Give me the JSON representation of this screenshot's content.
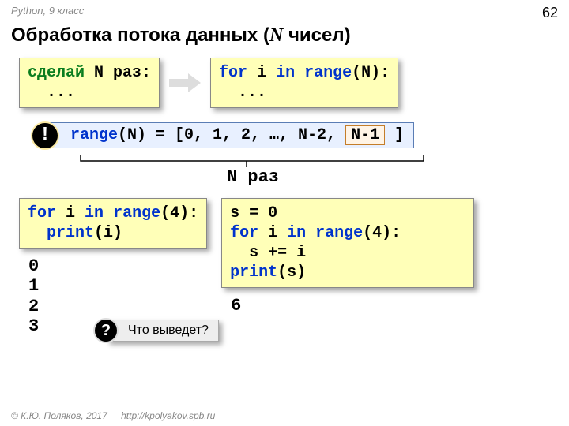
{
  "header": {
    "course": "Python, 9 класс",
    "page": "62"
  },
  "title": {
    "a": "Обработка потока данных (",
    "ital": "N",
    "b": " чисел)"
  },
  "box_pseudo": {
    "l1a": "сделай",
    "l1b": " N раз",
    "l1c": ":",
    "l2": "  ..."
  },
  "box_for": {
    "l1a": "for",
    "l1b": " i ",
    "l1c": "in",
    "l1d": " ",
    "l1e": "range",
    "l1f": "(N):",
    "l2": "  ..."
  },
  "range_line": {
    "a": "range",
    "b": "(N) = [0, 1, 2, …, N-2, ",
    "boxed": "N-1",
    "d": " ]"
  },
  "bracket_label": "N раз",
  "box_for4": {
    "l1a": "for",
    "l1b": " i ",
    "l1c": "in",
    "l1d": " ",
    "l1e": "range",
    "l1f": "(4):",
    "l2a": "  ",
    "l2b": "print",
    "l2c": "(i)"
  },
  "box_sum": {
    "l1": "s = 0",
    "l2a": "for",
    "l2b": " i ",
    "l2c": "in",
    "l2d": " ",
    "l2e": "range",
    "l2f": "(4):",
    "l3": "  s += i",
    "l4a": "print",
    "l4b": "(s)"
  },
  "out_left": [
    "0",
    "1",
    "2",
    "3"
  ],
  "out_right": "6",
  "q_text": "Что выведет?",
  "badge_excl": "!",
  "badge_q": "?",
  "footer": {
    "copy": "© К.Ю. Поляков, 2017",
    "url": "http://kpolyakov.spb.ru"
  }
}
